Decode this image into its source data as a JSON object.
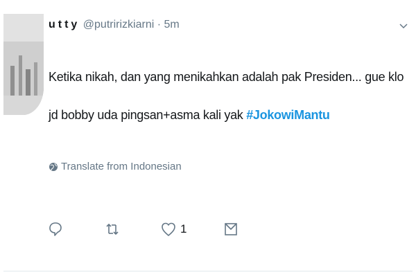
{
  "tweet": {
    "display_name": "utty",
    "handle": "@putririzkiarni",
    "separator": "·",
    "time": "5m",
    "text_main": "Ketika nikah, dan yang menikahkan adalah pak Presiden... gue klo jd bobby uda pingsan+asma kali yak ",
    "hashtag": "#JokowiMantu",
    "translate_label": "Translate from Indonesian",
    "like_count": "1"
  },
  "icons": {
    "menu": "chevron-down-icon",
    "translate": "globe-icon",
    "reply": "reply-icon",
    "retweet": "retweet-icon",
    "like": "heart-icon",
    "message": "direct-message-icon"
  },
  "colors": {
    "text": "#14171a",
    "secondary": "#657786",
    "link": "#1b95e0",
    "divider": "#e1e8ed"
  }
}
